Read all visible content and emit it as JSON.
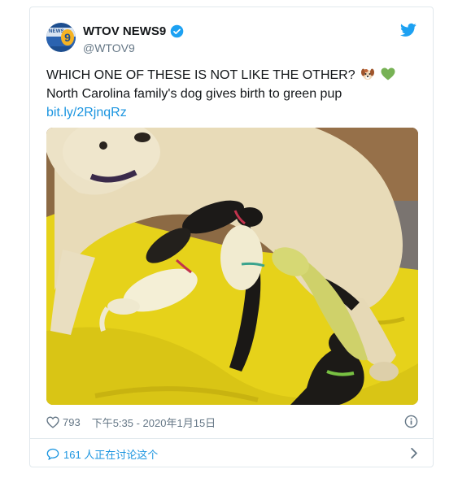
{
  "account": {
    "display_name": "WTOV NEWS9",
    "handle": "@WTOV9",
    "avatar_text": "NEWS",
    "avatar_number": "9",
    "verified_icon": "verified-badge-icon"
  },
  "tweet": {
    "line1": "WHICH ONE OF THESE IS NOT LIKE THE OTHER?",
    "line2": "North Carolina family's dog gives birth to green pup",
    "link": "bit.ly/2RjnqRz",
    "emojis": [
      "dog-face-emoji",
      "green-heart-emoji"
    ]
  },
  "meta": {
    "likes": "793",
    "timestamp": "下午5:35 - 2020年1月15日"
  },
  "discussion": {
    "label": "161 人正在讨论这个"
  },
  "colors": {
    "link_blue": "#1b95e0",
    "muted_gray": "#657786",
    "border": "#e1e8ed"
  }
}
